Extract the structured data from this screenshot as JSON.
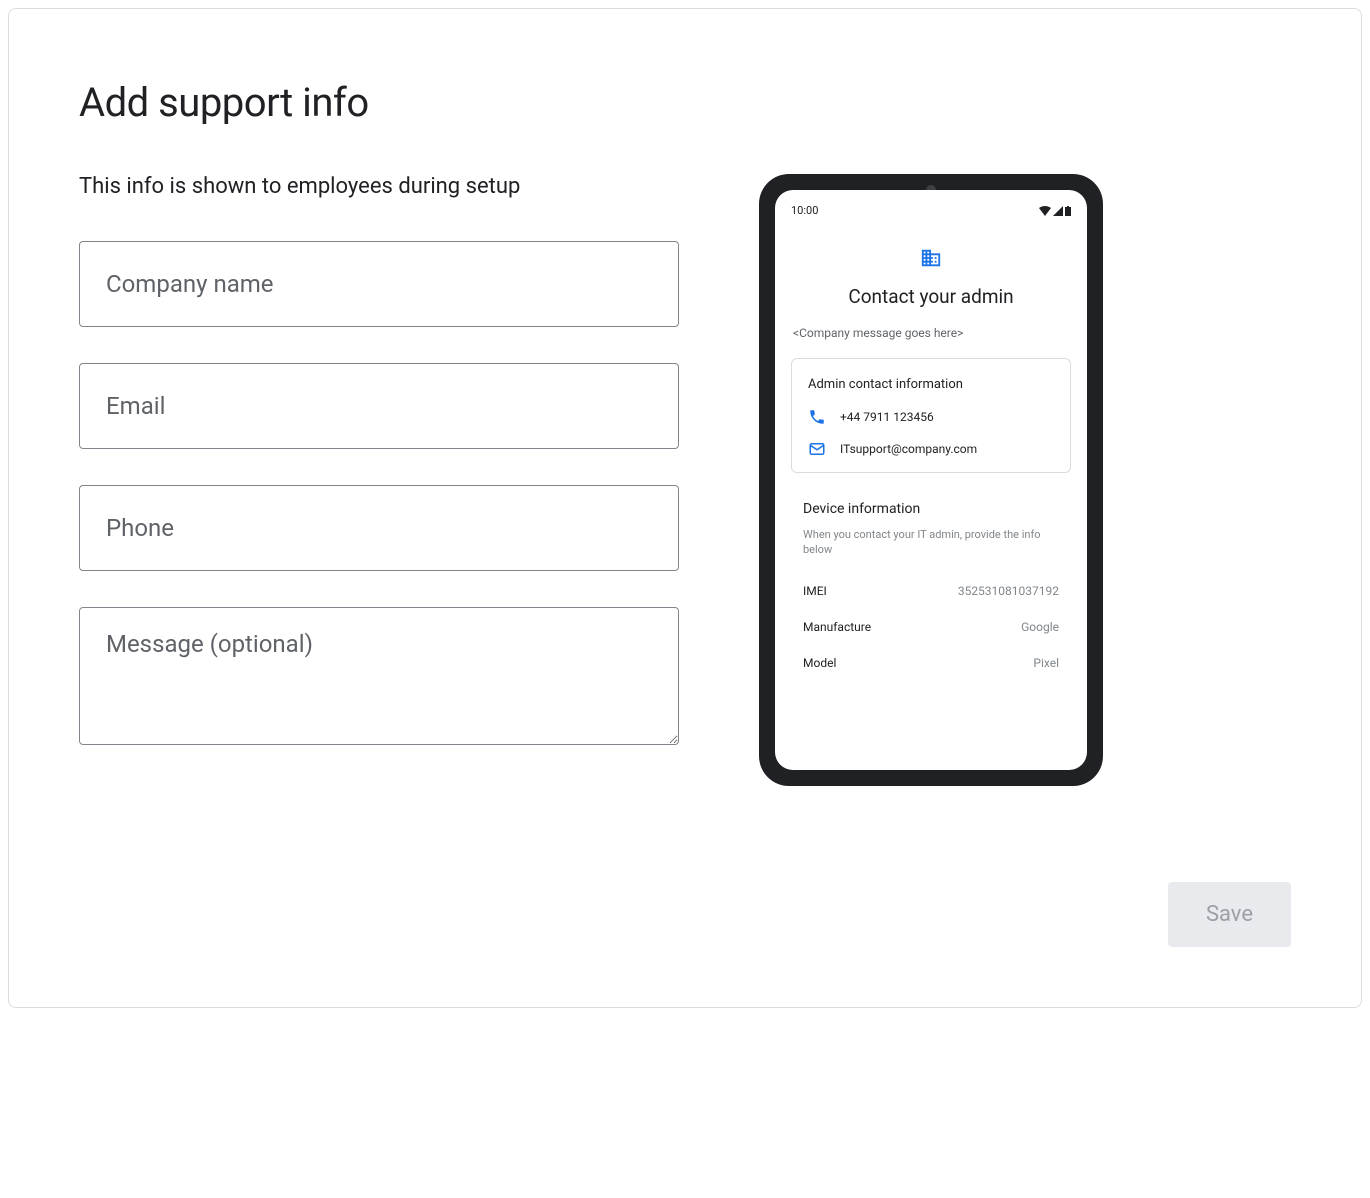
{
  "header": {
    "title": "Add support info",
    "subtitle": "This info is shown to employees during setup"
  },
  "form": {
    "company_placeholder": "Company name",
    "email_placeholder": "Email",
    "phone_placeholder": "Phone",
    "message_placeholder": "Message (optional)"
  },
  "preview": {
    "status_time": "10:00",
    "screen_title": "Contact your admin",
    "company_message": "<Company message goes here>",
    "contact_card_title": "Admin contact information",
    "contact_phone": "+44 7911 123456",
    "contact_email": "ITsupport@company.com",
    "device_title": "Device information",
    "device_desc": "When you contact your IT admin, provide the info below",
    "device_rows": [
      {
        "label": "IMEI",
        "value": "352531081037192"
      },
      {
        "label": "Manufacture",
        "value": "Google"
      },
      {
        "label": "Model",
        "value": "Pixel"
      }
    ]
  },
  "actions": {
    "save_label": "Save"
  }
}
